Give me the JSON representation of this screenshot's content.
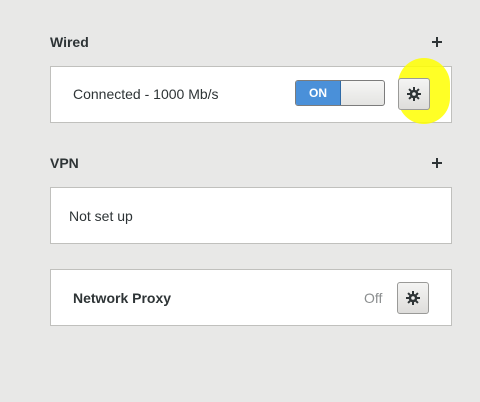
{
  "wired": {
    "header": "Wired",
    "status": "Connected - 1000 Mb/s",
    "toggle_label": "ON"
  },
  "vpn": {
    "header": "VPN",
    "status": "Not set up"
  },
  "proxy": {
    "label": "Network Proxy",
    "state": "Off"
  },
  "icons": {
    "add": "plus-icon",
    "settings": "gear-icon"
  },
  "colors": {
    "accent": "#4a90d9",
    "highlight": "#ffff00",
    "background": "#e8e8e7"
  }
}
